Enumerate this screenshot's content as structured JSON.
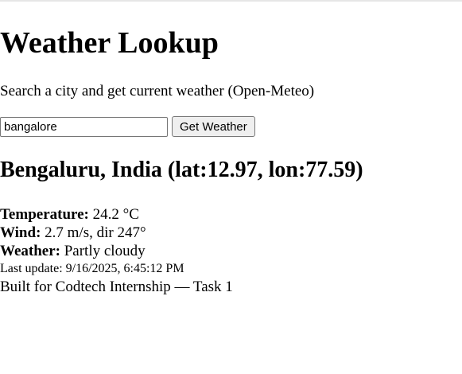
{
  "page": {
    "title": "Weather Lookup",
    "subtitle": "Search a city and get current weather (Open-Meteo)"
  },
  "search": {
    "value": "bangalore",
    "button_label": "Get Weather"
  },
  "result": {
    "location": "Bengaluru, India (lat:12.97, lon:77.59)",
    "temperature_label": "Temperature:",
    "temperature_value": "24.2 °C",
    "wind_label": "Wind:",
    "wind_value": "2.7 m/s, dir 247°",
    "weather_label": "Weather:",
    "weather_value": "Partly cloudy",
    "last_update": "Last update: 9/16/2025, 6:45:12 PM"
  },
  "footer": {
    "text": "Built for Codtech Internship — Task 1"
  }
}
